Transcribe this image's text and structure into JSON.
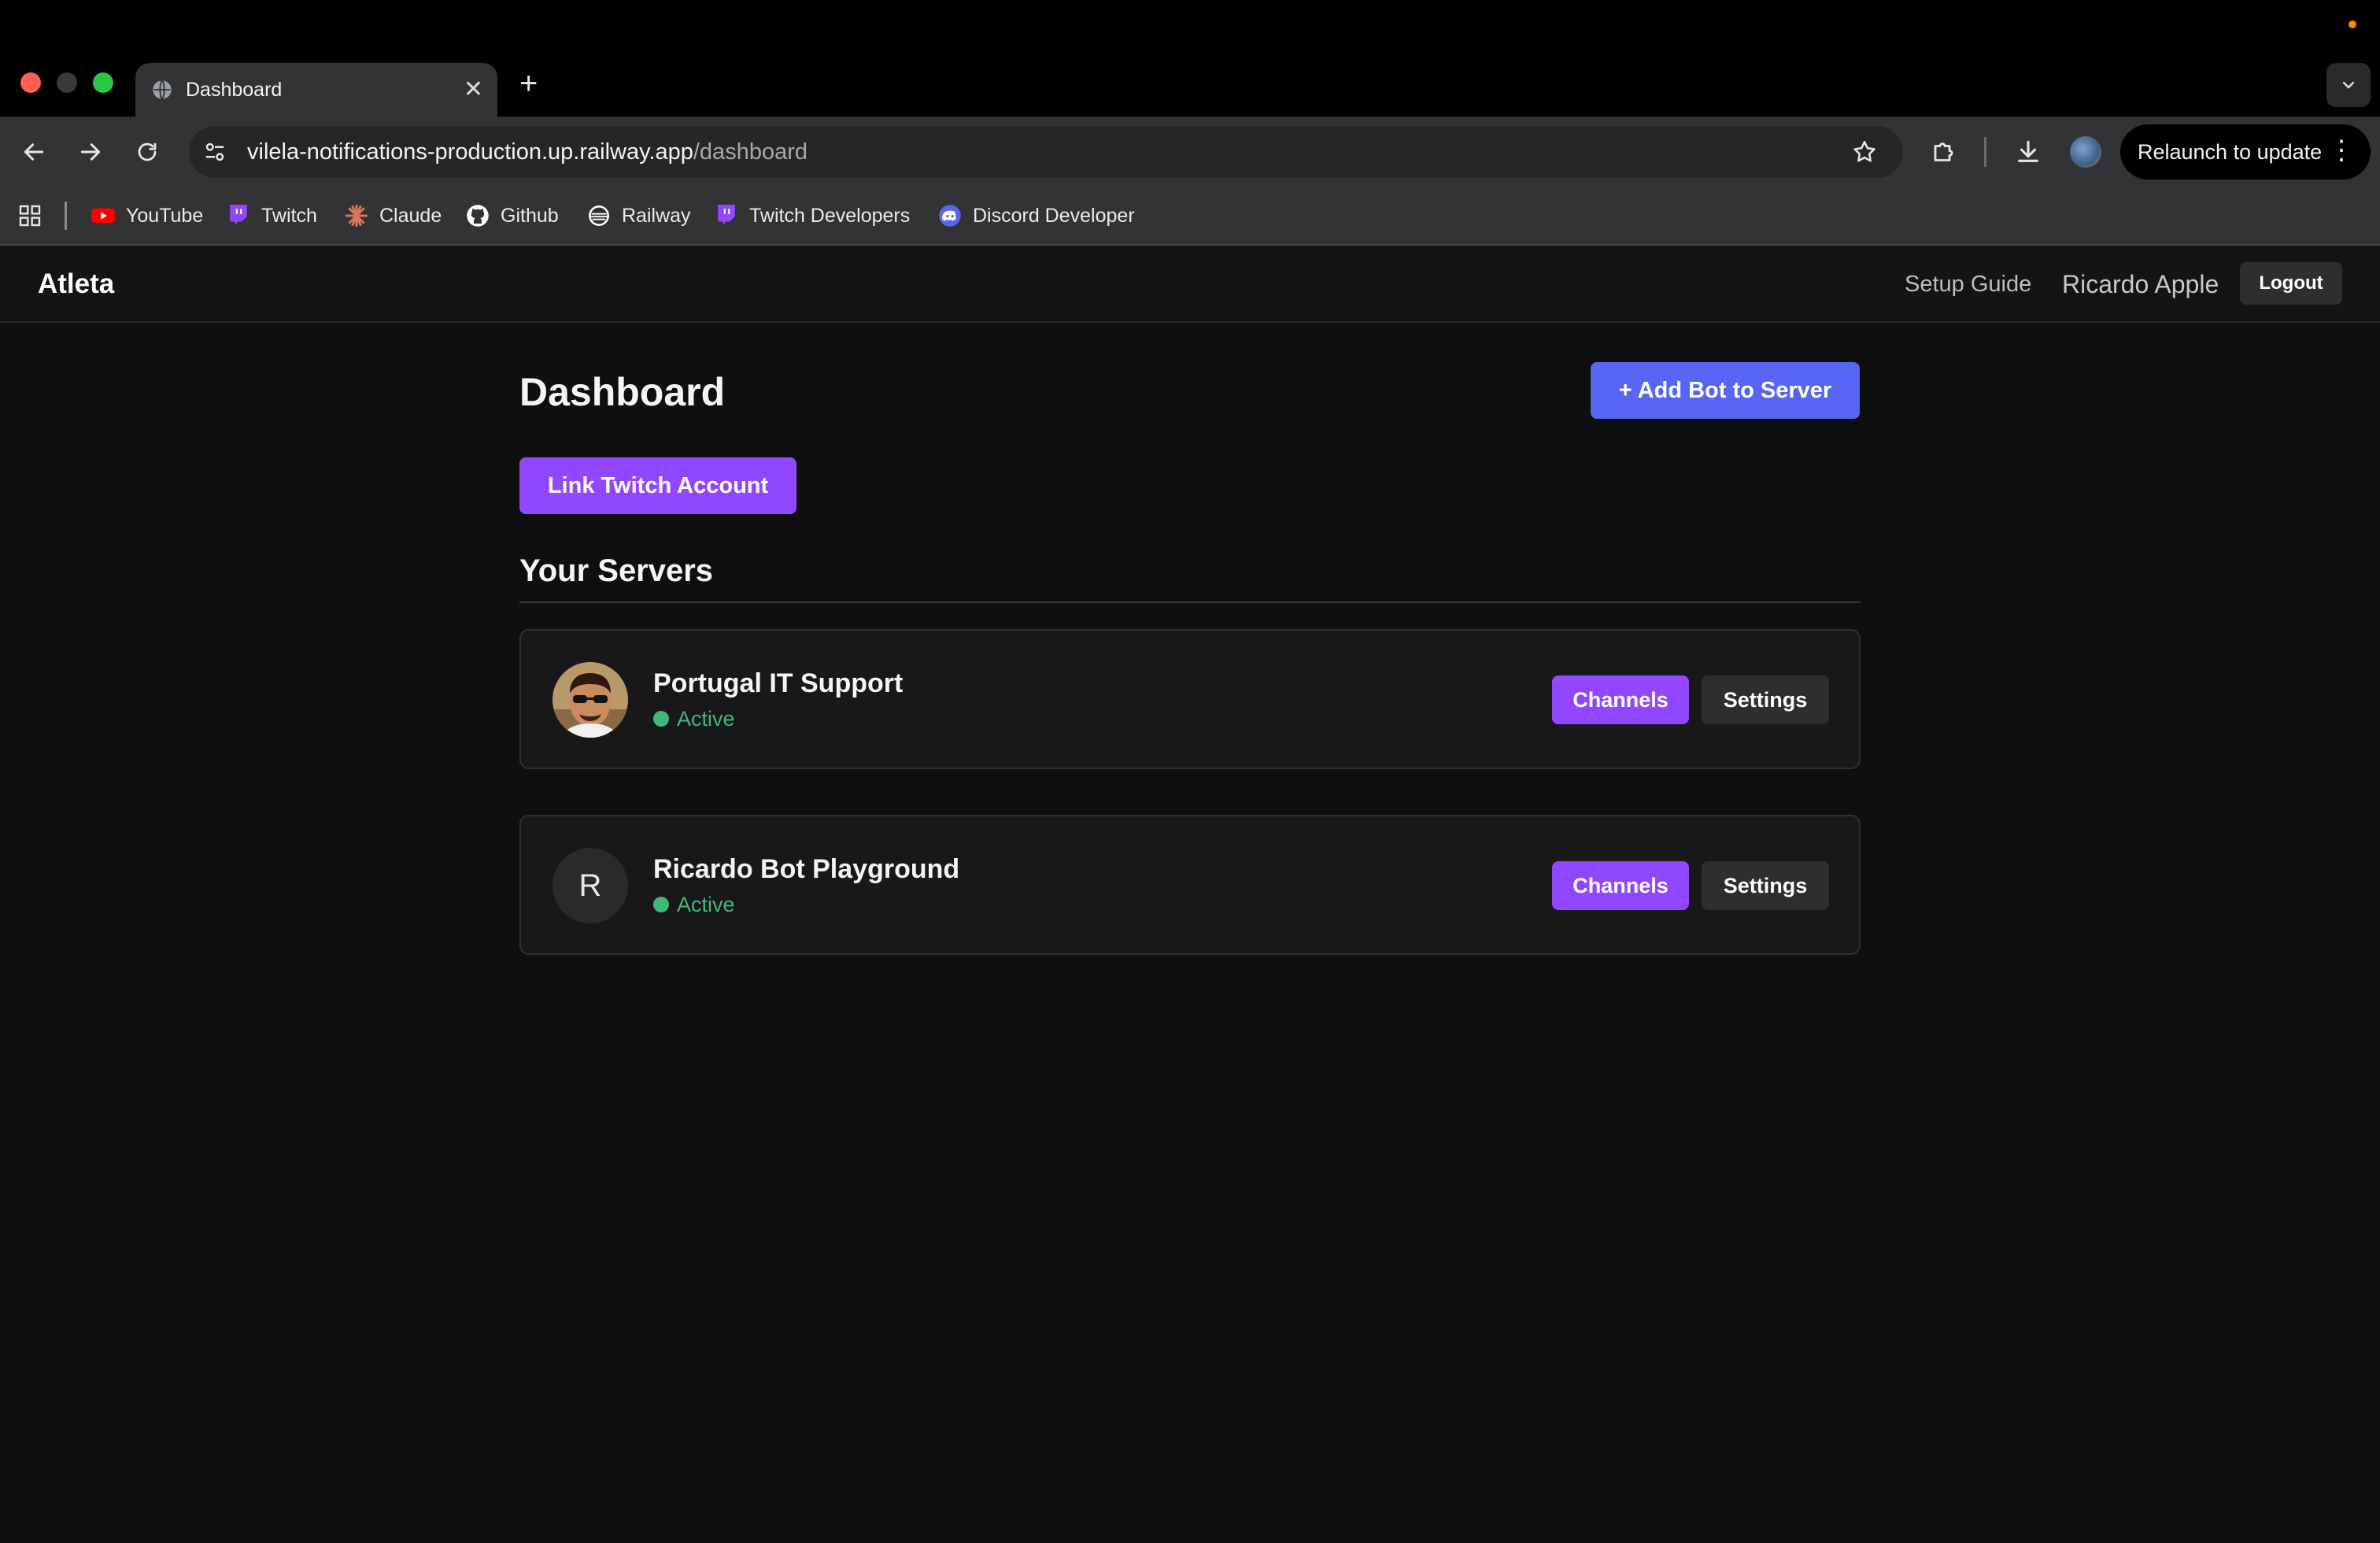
{
  "browser": {
    "tab_title": "Dashboard",
    "new_tab": "+",
    "close": "✕",
    "url_host": "vilela-notifications-production.up.railway.app",
    "url_path": "/dashboard",
    "relaunch_label": "Relaunch to update",
    "bookmarks": [
      {
        "label": "YouTube",
        "icon": "youtube-icon",
        "color": "#ff0000"
      },
      {
        "label": "Twitch",
        "icon": "twitch-icon",
        "color": "#9146ff"
      },
      {
        "label": "Claude",
        "icon": "claude-icon",
        "color": "#d97757"
      },
      {
        "label": "Github",
        "icon": "github-icon",
        "color": "#ffffff"
      },
      {
        "label": "Railway",
        "icon": "railway-icon",
        "color": "#ffffff"
      },
      {
        "label": "Twitch Developers",
        "icon": "twitch-icon",
        "color": "#9146ff"
      },
      {
        "label": "Discord Developer",
        "icon": "discord-icon",
        "color": "#5865f2"
      }
    ]
  },
  "header": {
    "brand": "Atleta",
    "setup_guide": "Setup Guide",
    "user_name": "Ricardo Apple",
    "logout": "Logout"
  },
  "main": {
    "title": "Dashboard",
    "add_bot_button": "+ Add Bot to Server",
    "link_twitch_button": "Link Twitch Account",
    "servers_heading": "Your Servers",
    "servers": [
      {
        "name": "Portugal IT Support",
        "status": "Active",
        "avatar": "photo",
        "channels": "Channels",
        "settings": "Settings"
      },
      {
        "name": "Ricardo Bot Playground",
        "status": "Active",
        "avatar_letter": "R",
        "channels": "Channels",
        "settings": "Settings"
      }
    ]
  },
  "colors": {
    "twitch_purple": "#9146ff",
    "discord_blurple": "#5865f2",
    "active_green": "#3fb87a",
    "background": "#0f0f11"
  }
}
